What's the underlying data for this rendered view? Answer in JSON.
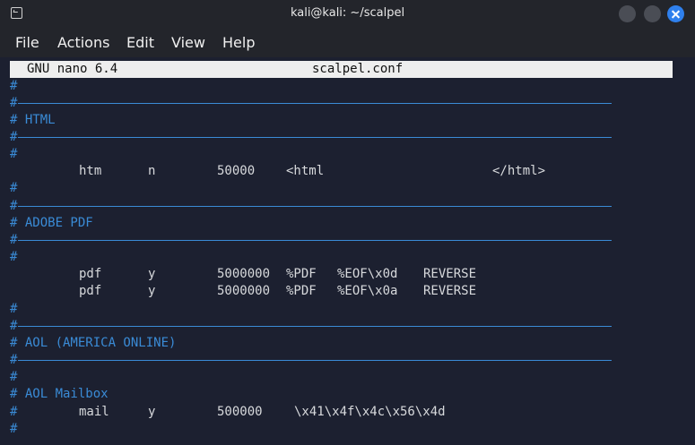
{
  "window": {
    "title": "kali@kali: ~/scalpel"
  },
  "menu": {
    "items": [
      "File",
      "Actions",
      "Edit",
      "View",
      "Help"
    ]
  },
  "nano": {
    "version": "GNU nano 6.4",
    "filename": "scalpel.conf"
  },
  "content": {
    "hash": "#",
    "sections": {
      "html": "# HTML",
      "pdf": "# ADOBE PDF",
      "aol": "# AOL (AMERICA ONLINE)",
      "aol_mailbox": "# AOL Mailbox"
    },
    "rows": {
      "htm": [
        "htm",
        "n",
        "50000",
        "<html",
        "</html>"
      ],
      "pdf1": [
        "pdf",
        "y",
        "5000000",
        "%PDF",
        "%EOF\\x0d",
        "REVERSE"
      ],
      "pdf2": [
        "pdf",
        "y",
        "5000000",
        "%PDF",
        "%EOF\\x0a",
        "REVERSE"
      ],
      "mail": [
        "mail",
        "y",
        "500000",
        "\\x41\\x4f\\x4c\\x56\\x4d"
      ]
    }
  },
  "colors": {
    "comment": "#3a8bd6",
    "close_button": "#2f80ed",
    "header_bg": "#eeeeee"
  }
}
